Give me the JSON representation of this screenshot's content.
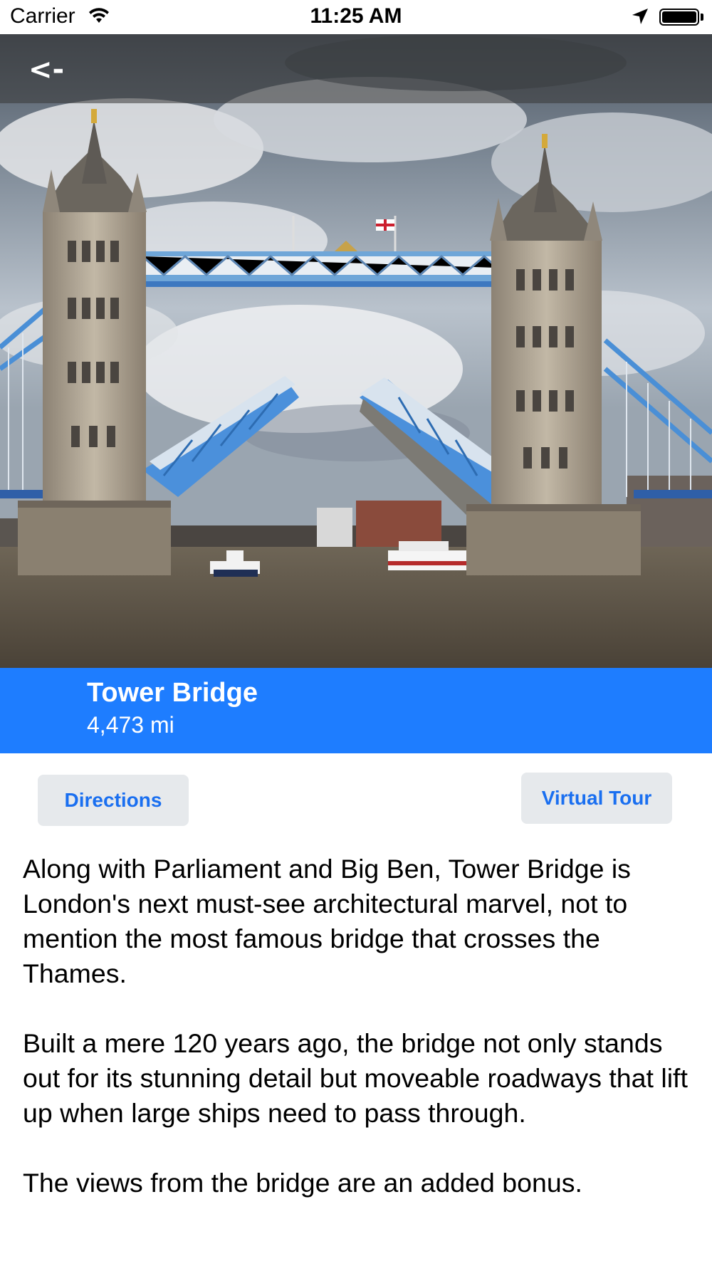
{
  "status_bar": {
    "carrier": "Carrier",
    "time": "11:25 AM",
    "icons": [
      "wifi-icon",
      "location-arrow-icon",
      "battery-icon"
    ]
  },
  "nav": {
    "back_label": "<-"
  },
  "hero": {
    "image": "Tower Bridge photo with raised bascules over the Thames under cloudy sky"
  },
  "place": {
    "title": "Tower Bridge",
    "distance": "4,473 mi"
  },
  "actions": {
    "directions_label": "Directions",
    "virtual_tour_label": "Virtual Tour"
  },
  "description": {
    "paragraphs": [
      "Along with Parliament and Big Ben, Tower Bridge is London's next must-see architectural marvel, not to mention the most famous bridge that crosses the Thames.",
      "Built a mere 120 years ago, the bridge not only stands out for its stunning detail but moveable roadways that lift up when large ships need to pass through.",
      "The views from the bridge are an added bonus."
    ]
  },
  "colors": {
    "accent_band": "#1e7dff",
    "button_text": "#1a6ff0",
    "button_bg": "#e6e9ec"
  }
}
